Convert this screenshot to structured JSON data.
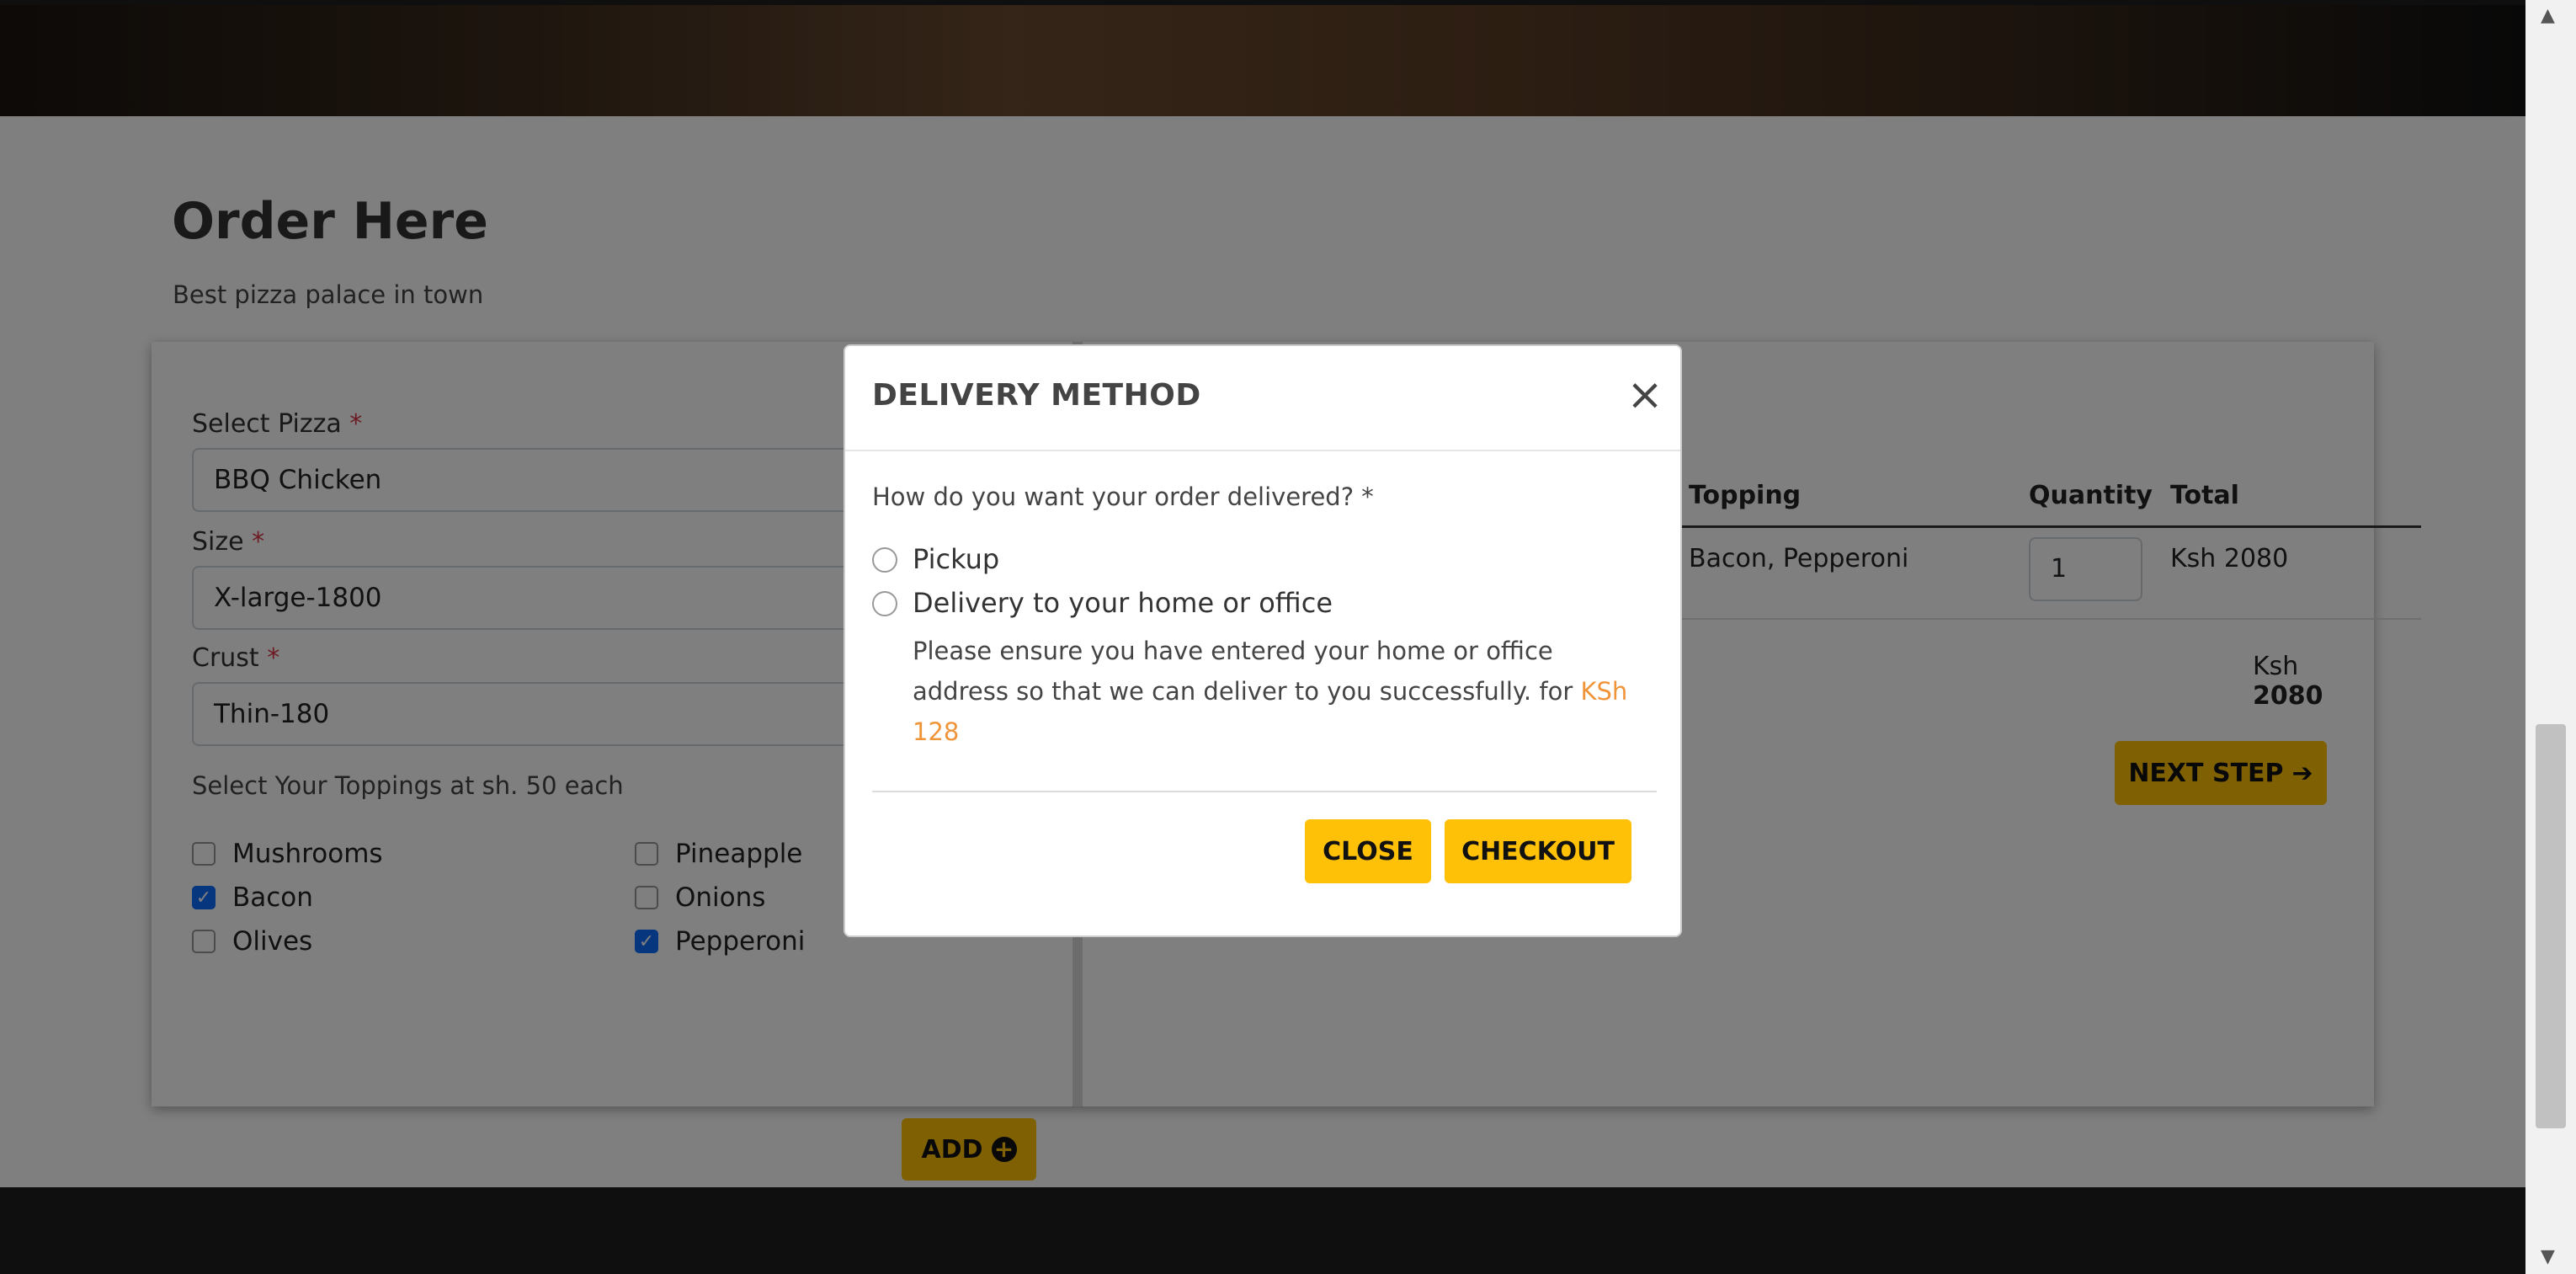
{
  "order": {
    "title": "Order Here",
    "subtitle": "Best pizza palace in town",
    "form": {
      "pizza_label": "Select Pizza",
      "pizza_value": "BBQ Chicken",
      "size_label": "Size",
      "size_value": "X-large-1800",
      "crust_label": "Crust",
      "crust_value": "Thin-180",
      "required_mark": "*",
      "toppings_hint": "Select Your Toppings at sh. 50 each",
      "toppings": [
        {
          "label": "Mushrooms",
          "checked": false
        },
        {
          "label": "Pineapple",
          "checked": false
        },
        {
          "label": "Bacon",
          "checked": true
        },
        {
          "label": "Onions",
          "checked": false
        },
        {
          "label": "Olives",
          "checked": false
        },
        {
          "label": "Pepperoni",
          "checked": true
        }
      ],
      "add_label": "ADD"
    },
    "cart": {
      "headers": {
        "topping": "Topping",
        "quantity": "Quantity",
        "total": "Total"
      },
      "rows": [
        {
          "topping": "Bacon, Pepperoni",
          "quantity": "1",
          "total": "Ksh 2080"
        }
      ],
      "grand_total_prefix": "Ksh",
      "grand_total_value": "2080",
      "next_label": "NEXT STEP"
    }
  },
  "modal": {
    "title": "DELIVERY METHOD",
    "question": "How do you want your order delivered? *",
    "options": [
      "Pickup",
      "Delivery to your home or office"
    ],
    "description": "Please ensure you have entered your home or office address so that we can deliver to you successfully. for ",
    "price": "KSh 128",
    "close_label": "CLOSE",
    "checkout_label": "CHECKOUT"
  },
  "colors": {
    "accent": "#ffc107",
    "checkbox": "#0d6efd",
    "price": "#f0943a",
    "required": "#dc3545",
    "footer": "#1f1f1f"
  },
  "icons": {
    "modal_close": "close-icon",
    "add": "plus-circle-icon",
    "next": "arrow-right-icon",
    "check": "checkmark-icon"
  }
}
